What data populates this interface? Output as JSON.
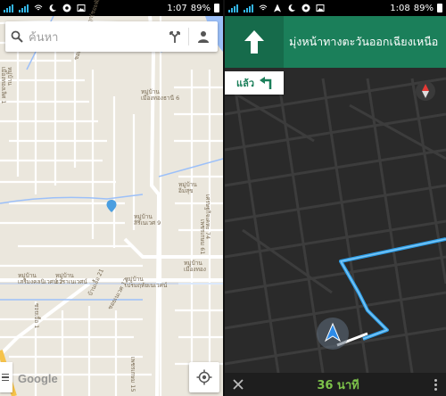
{
  "left_screen": {
    "status_bar": {
      "time": "1:07",
      "battery": "89%"
    },
    "search": {
      "placeholder": "ค้นหา"
    },
    "map_labels": [
      "หมู่บ้าน\nเมืองทองธานี 6",
      "หมู่บ้าน\nเมืองทองเลิศ 1",
      "ซอยวัดลาดปลาดุก(ซอยพัฒนา 1)",
      "หมู่บ้าน\nอิ่มสุข",
      "หมู่บ้าน\nเมืองทอง",
      "หมู่บ้าน\nสิริเนเวศ 9",
      "เศรษฐกิจเคหะ 74",
      "เพชรเกษม 61",
      "หมู่บ้าน\nธาราเนเวศน์",
      "หมู่บ้าน\nเสรีมงคลนิเวศน์ 2",
      "หมู่บ้าน\nเปรมฤทัยเนเวศน์",
      "บ้านเอื้อ 21",
      "ซอยเอื้อ 1",
      "ซอยเนเวศ 12",
      "เพชรเกษม 15"
    ],
    "google_logo": "Google",
    "icons": {
      "search": "search-icon",
      "directions": "directions-icon",
      "account": "account-icon",
      "menu": "menu-icon",
      "my_location": "my-location-icon"
    }
  },
  "right_screen": {
    "status_bar": {
      "time": "1:08",
      "battery": "89%"
    },
    "navigation": {
      "instruction": "มุ่งหน้าทางตะวันออกเฉียงเหนือ",
      "then_label": "แล้ว",
      "eta": "36 นาที"
    },
    "icons": {
      "straight_arrow": "straight-arrow-icon",
      "turn_left": "turn-left-icon",
      "compass": "compass-icon",
      "close": "close-icon",
      "more": "more-vert-icon"
    }
  },
  "colors": {
    "nav_green": "#1b7f5a",
    "route_blue": "#2d9ee8",
    "eta_green": "#7dc34a",
    "map_bg": "#ebe7dd",
    "nav_map_bg": "#2a2a2a"
  }
}
